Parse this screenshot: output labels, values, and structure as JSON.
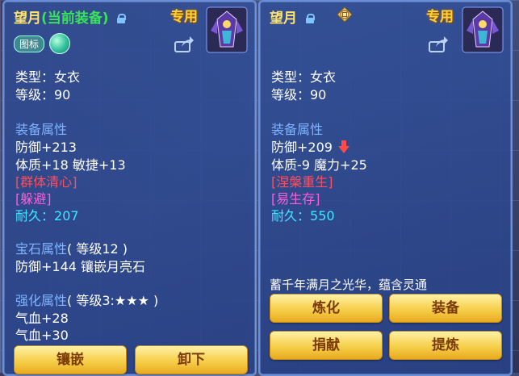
{
  "left": {
    "title_name": "望月",
    "title_paren": "(当前装备)",
    "badge": "专用",
    "toggle_label": "图标",
    "type_line": "类型：女衣",
    "level_line": "等级：90",
    "attr_header": "装备属性",
    "defense": "防御+213",
    "stats": "体质+18 敏捷+13",
    "skill": "[群体清心]",
    "effect": "[躲避]",
    "durability_label": "耐久：",
    "durability_value": "207",
    "gem_header": "宝石属性",
    "gem_level": "( 等级12 )",
    "gem_line": "防御+144 镶嵌月亮石",
    "strengthen_header": "强化属性",
    "strengthen_level": "( 等级3:★★★ )",
    "hp1": "气血+28",
    "hp2": "气血+30",
    "btn_inlay": "镶嵌",
    "btn_unequip": "卸下"
  },
  "right": {
    "title_name": "望月",
    "badge": "专用",
    "type_line": "类型：女衣",
    "level_line": "等级：90",
    "attr_header": "装备属性",
    "defense": "防御+209",
    "stats": "体质-9 魔力+25",
    "skill": "[涅槃重生]",
    "effect": "[易生存]",
    "durability_label": "耐久：",
    "durability_value": "550",
    "description": "蓄千年满月之光华，蕴含灵通",
    "btn_refine": "炼化",
    "btn_equip": "装备",
    "btn_donate": "捐献",
    "btn_extract": "提炼"
  },
  "colors": {
    "title": "#ffe36a",
    "section": "#7fb4ff",
    "skill": "#ff4f5e",
    "effect": "#ff5cd6",
    "durability": "#3ee8ff",
    "button": "#f6cf4a"
  }
}
